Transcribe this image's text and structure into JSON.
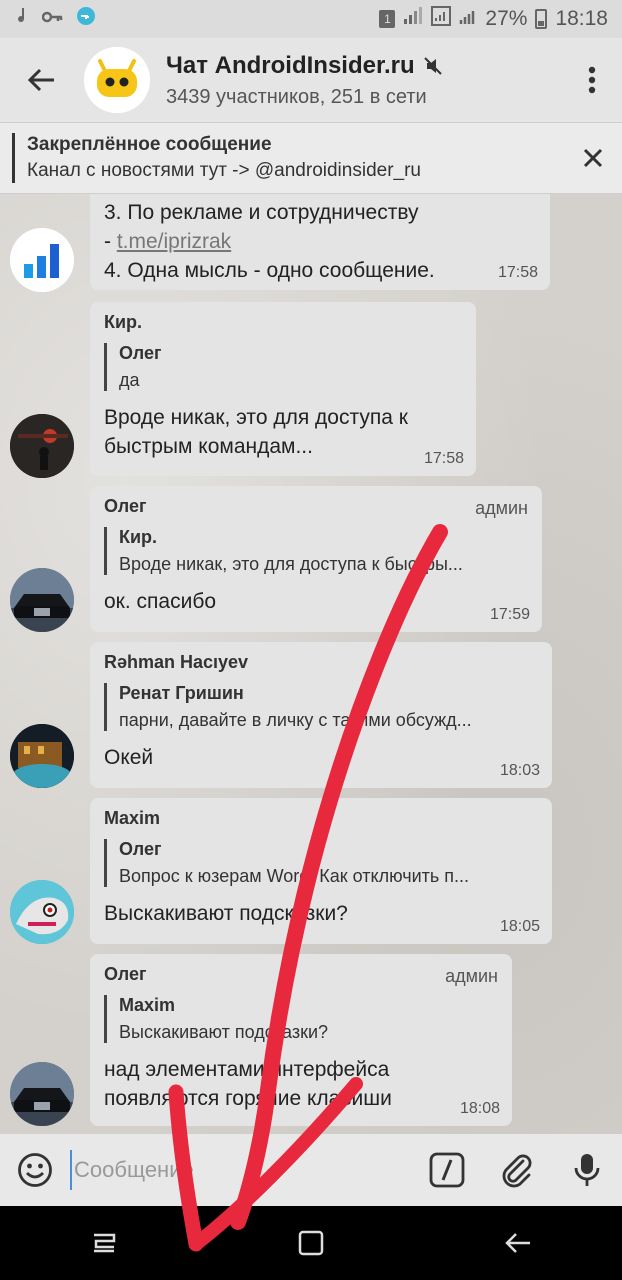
{
  "status_bar": {
    "battery": "27%",
    "time": "18:18",
    "notif_badge": "1"
  },
  "header": {
    "title": "Чат AndroidInsider.ru",
    "subtitle": "3439 участников, 251 в сети"
  },
  "pinned": {
    "title": "Закреплённое сообщение",
    "text": "Канал с новостями тут -> @androidinsider_ru"
  },
  "messages": [
    {
      "lines": [
        "3. По рекламе и сотрудничеству",
        "- ",
        "t.me/iprizrak",
        "4. Одна мысль - одно сообщение."
      ],
      "time": "17:58"
    },
    {
      "sender": "Кир.",
      "reply_name": "Олег",
      "reply_text": "да",
      "text": "Вроде никак, это для доступа к быстрым командам...",
      "time": "17:58"
    },
    {
      "sender": "Олег",
      "role": "админ",
      "reply_name": "Кир.",
      "reply_text": "Вроде никак, это для доступа к быстры...",
      "text": "ок. спасибо",
      "time": "17:59"
    },
    {
      "sender": "Rəhman Hacıyev",
      "reply_name": "Ренат Гришин",
      "reply_text": "парни, давайте в личку с такими обсужд...",
      "text": "Окей",
      "time": "18:03"
    },
    {
      "sender": "Maxim",
      "reply_name": "Олег",
      "reply_text": "Вопрос к юзерам Word. Как отключить п...",
      "text": "Выскакивают подсказки?",
      "time": "18:05"
    },
    {
      "sender": "Олег",
      "role": "админ",
      "reply_name": "Maxim",
      "reply_text": "Выскакивают подсказки?",
      "text": "над элементами интерфейса появляются горячие клавиши",
      "time": "18:08"
    }
  ],
  "input": {
    "placeholder": "Сообщение"
  },
  "colors": {
    "annotation": "#e8283c",
    "bubble": "#e4e4e4",
    "caret": "#4a90d9"
  }
}
